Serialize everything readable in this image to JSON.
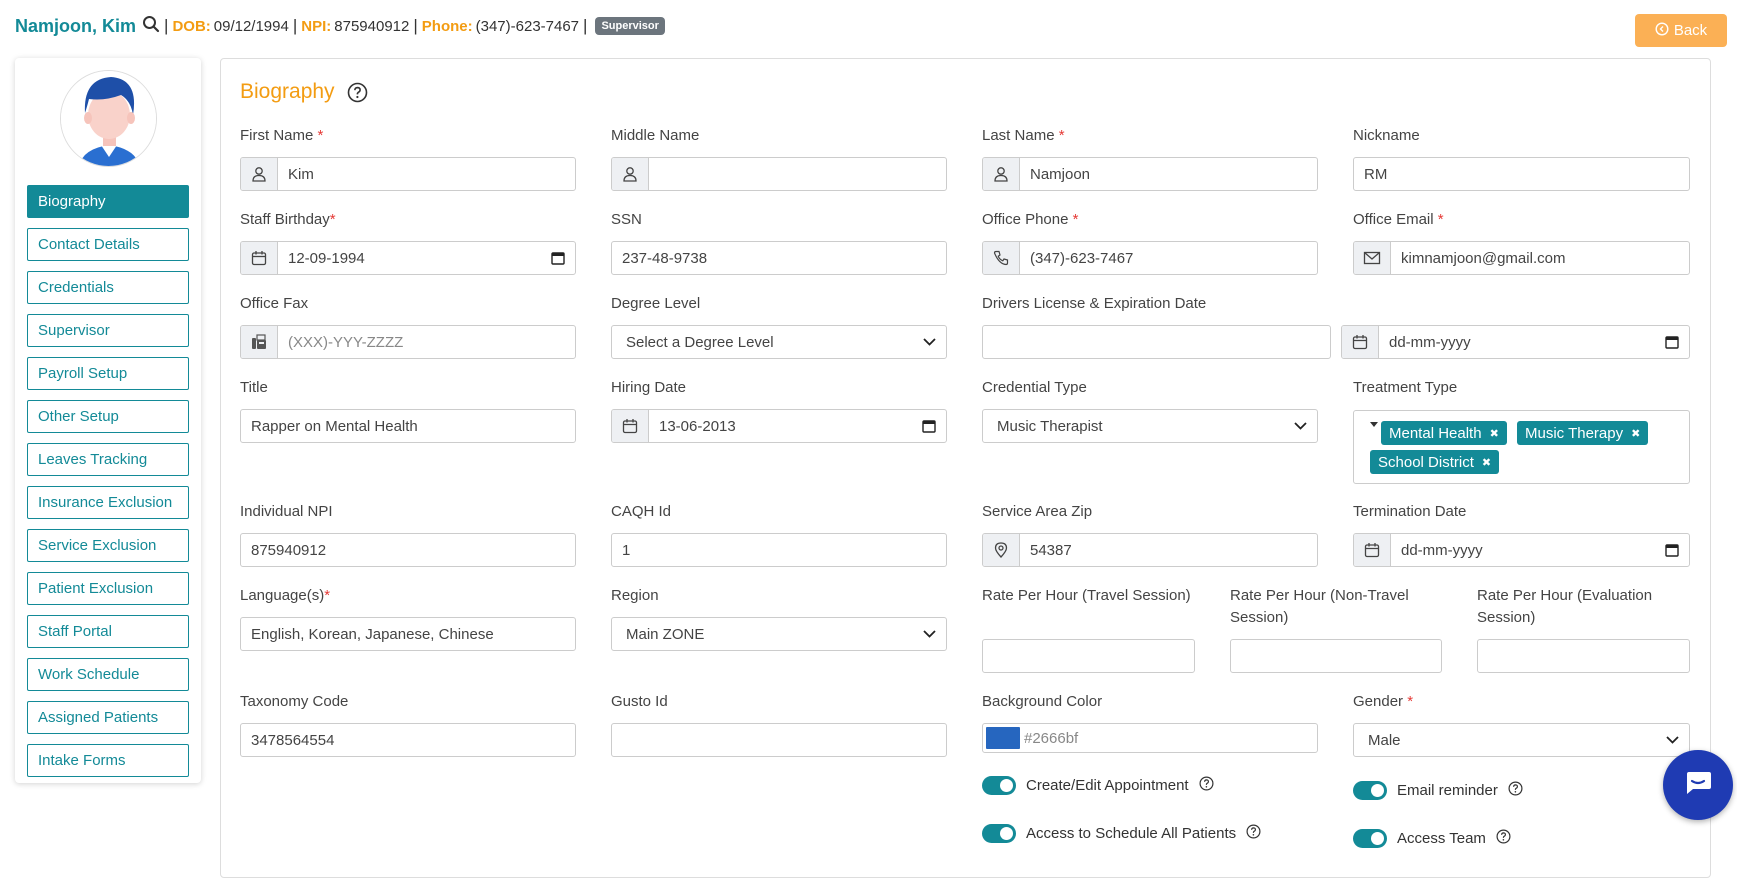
{
  "header": {
    "patient_name": "Namjoon, Kim",
    "dob_label": "DOB:",
    "dob_value": "09/12/1994",
    "npi_label": "NPI:",
    "npi_value": "875940912",
    "phone_label": "Phone:",
    "phone_value": "(347)-623-7467",
    "separator": "|",
    "role_badge": "Supervisor",
    "back_label": "Back"
  },
  "sidebar": {
    "items": [
      {
        "label": "Biography",
        "active": true
      },
      {
        "label": "Contact Details"
      },
      {
        "label": "Credentials"
      },
      {
        "label": "Supervisor"
      },
      {
        "label": "Payroll Setup"
      },
      {
        "label": "Other Setup"
      },
      {
        "label": "Leaves Tracking"
      },
      {
        "label": "Insurance Exclusion"
      },
      {
        "label": "Service Exclusion"
      },
      {
        "label": "Patient Exclusion"
      },
      {
        "label": "Staff Portal"
      },
      {
        "label": "Work Schedule"
      },
      {
        "label": "Assigned Patients"
      },
      {
        "label": "Intake Forms"
      }
    ]
  },
  "section": {
    "title": "Biography"
  },
  "fields": {
    "first_name": {
      "label": "First Name",
      "value": "Kim"
    },
    "middle_name": {
      "label": "Middle Name",
      "value": ""
    },
    "last_name": {
      "label": "Last Name",
      "value": "Namjoon"
    },
    "nickname": {
      "label": "Nickname",
      "value": "RM"
    },
    "birthday": {
      "label": "Staff Birthday",
      "value": "12-09-1994"
    },
    "ssn": {
      "label": "SSN",
      "value": "237-48-9738"
    },
    "office_phone": {
      "label": "Office Phone",
      "value": "(347)-623-7467"
    },
    "office_email": {
      "label": "Office Email",
      "value": "kimnamjoon@gmail.com"
    },
    "office_fax": {
      "label": "Office Fax",
      "placeholder": "(XXX)-YYY-ZZZZ"
    },
    "degree_level": {
      "label": "Degree Level",
      "value": "Select a Degree Level"
    },
    "drivers_license": {
      "label": "Drivers License & Expiration Date",
      "value": "",
      "date_placeholder": "dd-mm-yyyy"
    },
    "title": {
      "label": "Title",
      "value": "Rapper on Mental Health"
    },
    "hiring_date": {
      "label": "Hiring Date",
      "value": "13-06-2013"
    },
    "credential_type": {
      "label": "Credential Type",
      "value": "Music Therapist"
    },
    "treatment_type": {
      "label": "Treatment Type",
      "tags": [
        "Mental Health",
        "Music Therapy",
        "School District"
      ],
      "remove_glyph": "✖"
    },
    "individual_npi": {
      "label": "Individual NPI",
      "value": "875940912"
    },
    "caqh_id": {
      "label": "CAQH Id",
      "value": "1"
    },
    "service_area_zip": {
      "label": "Service Area Zip",
      "value": "54387"
    },
    "termination_date": {
      "label": "Termination Date",
      "placeholder": "dd-mm-yyyy"
    },
    "languages": {
      "label": "Language(s)",
      "value": "English, Korean, Japanese, Chinese"
    },
    "region": {
      "label": "Region",
      "value": "Main ZONE"
    },
    "rate_travel": {
      "label": "Rate Per Hour (Travel Session)",
      "value": ""
    },
    "rate_non_travel": {
      "label": "Rate Per Hour (Non-Travel Session)",
      "value": ""
    },
    "rate_evaluation": {
      "label": "Rate Per Hour (Evaluation Session)",
      "value": ""
    },
    "taxonomy_code": {
      "label": "Taxonomy Code",
      "value": "3478564554"
    },
    "gusto_id": {
      "label": "Gusto Id",
      "value": ""
    },
    "background_color": {
      "label": "Background Color",
      "value": "#2666bf"
    },
    "gender": {
      "label": "Gender",
      "value": "Male"
    }
  },
  "toggles": {
    "create_edit_appointment": {
      "label": "Create/Edit Appointment",
      "on": true
    },
    "email_reminder": {
      "label": "Email reminder",
      "on": true
    },
    "access_schedule_all": {
      "label": "Access to Schedule All Patients",
      "on": true
    },
    "access_team": {
      "label": "Access Team",
      "on": true
    }
  },
  "required_mark": "*",
  "colors": {
    "teal": "#138a97",
    "orange": "#f39c12",
    "back_button": "#fbb055",
    "chat": "#1f3bb3"
  }
}
